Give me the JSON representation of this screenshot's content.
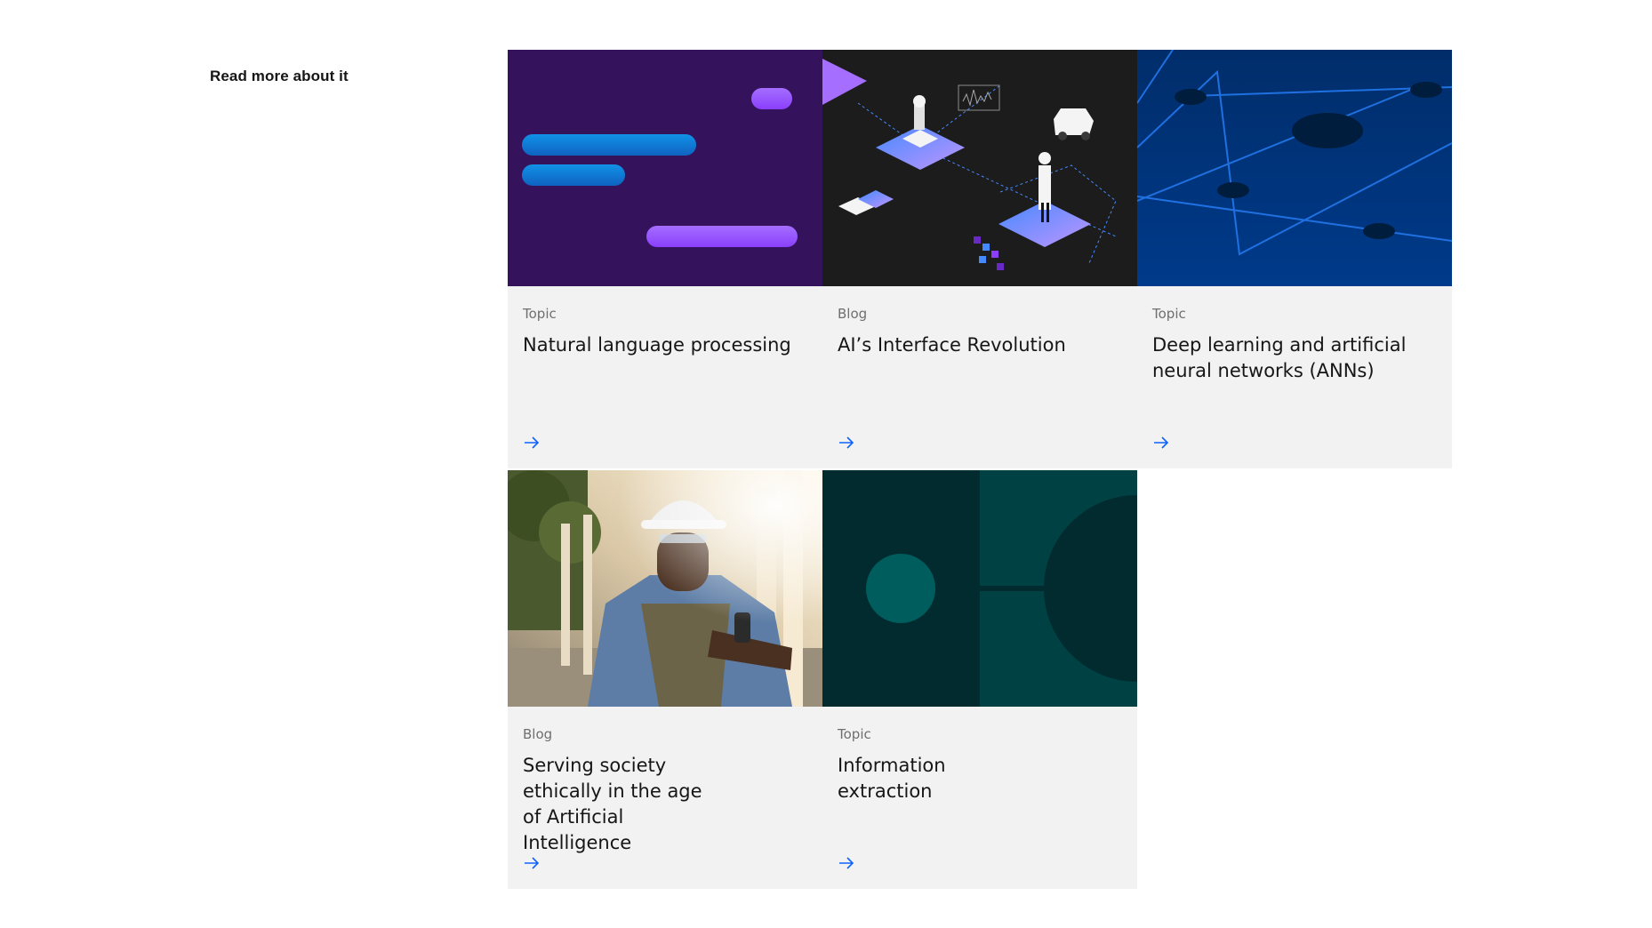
{
  "section": {
    "title": "Read more about it"
  },
  "cards": [
    {
      "eyebrow": "Topic",
      "title": "Natural language processing",
      "image": "nlp-abstract-image",
      "link_icon": "arrow-right-icon"
    },
    {
      "eyebrow": "Blog",
      "title": "AI’s Interface Revolution",
      "image": "isometric-ai-illustration",
      "link_icon": "arrow-right-icon"
    },
    {
      "eyebrow": "Topic",
      "title": "Deep learning and artificial neural networks (ANNs)",
      "image": "neural-network-abstract-image",
      "link_icon": "arrow-right-icon"
    },
    {
      "eyebrow": "Blog",
      "title": "Serving society ethically in the age of Artificial Intelligence",
      "image": "construction-worker-photo",
      "link_icon": "arrow-right-icon"
    },
    {
      "eyebrow": "Topic",
      "title": "Information extraction",
      "image": "information-extraction-abstract-image",
      "link_icon": "arrow-right-icon"
    }
  ],
  "colors": {
    "accent": "#0f62fe",
    "card_bg": "#f2f2f2",
    "eyebrow": "#6f6f6f",
    "text": "#161616"
  }
}
